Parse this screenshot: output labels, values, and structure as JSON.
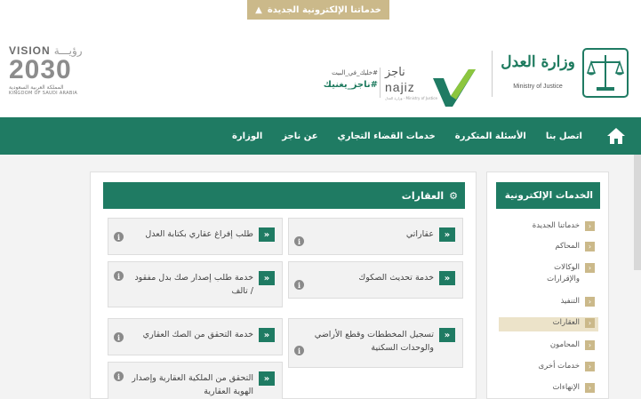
{
  "top_banner": {
    "label": "خدماتنا الإلكترونية الجديدة",
    "chevron": "chevron-up-icon"
  },
  "header": {
    "vision": {
      "vision_en": "VISION",
      "vision_ar": "رؤيـــة",
      "year": "2030",
      "kingdom_ar": "المملكة العربية السعودية",
      "kingdom_en": "KINGDOM OF SAUDI ARABIA"
    },
    "najiz": {
      "tagline_small": "#خليك_في_البيت",
      "tagline_main": "#ناجز_يغنيك",
      "brand_ar": "ناجز",
      "brand_en": "najiz",
      "brand_sub": "وزارة العدل - Ministry of Justice"
    },
    "moj": {
      "title_ar": "وزارة العدل",
      "title_en": "Ministry of Justice"
    }
  },
  "nav": {
    "items": [
      {
        "label": "الوزارة"
      },
      {
        "label": "عن ناجز"
      },
      {
        "label": "خدمات القضاء التجاري"
      },
      {
        "label": "الأسئلة المتكررة"
      },
      {
        "label": "اتصل بنا"
      }
    ]
  },
  "main": {
    "title": "العقارات",
    "cards": [
      {
        "label": "عقاراتي"
      },
      {
        "label": "طلب إفراغ عقاري بكتابة العدل"
      },
      {
        "label": "خدمة تحديث الصكوك"
      },
      {
        "label": "خدمة طلب إصدار صك بدل مفقود / تالف"
      },
      {
        "label": "تسجيل المخططات وقطع الأراضي والوحدات السكنية"
      },
      {
        "label": "خدمة التحقق من الصك العقاري"
      },
      {
        "label": "التحقق من الملكية العقارية وإصدار الهوية العقارية"
      }
    ]
  },
  "sidebar": {
    "title": "الخدمات الإلكترونية",
    "items": [
      {
        "label": "خدماتنا الجديدة"
      },
      {
        "label": "المحاكم"
      },
      {
        "label": "الوكالات والإقرارات"
      },
      {
        "label": "التنفيذ"
      },
      {
        "label": "العقارات"
      },
      {
        "label": "المحامون"
      },
      {
        "label": "خدمات أخرى"
      },
      {
        "label": "الإنهاءات"
      }
    ],
    "active_index": 4
  },
  "colors": {
    "primary_green": "#1f7b63",
    "gold": "#cbb98a",
    "active_bg": "#ece3c9"
  }
}
